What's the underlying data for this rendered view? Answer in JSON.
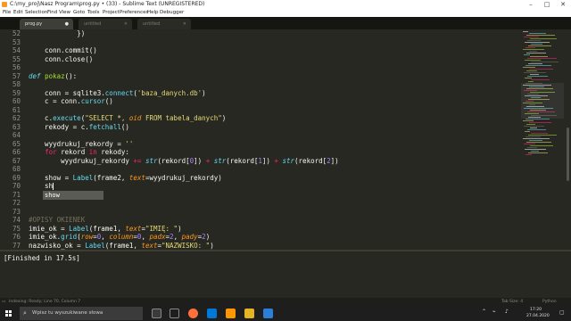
{
  "window": {
    "title": "C:\\my_proj\\Nasz Program\\prog.py • (33) - Sublime Text (UNREGISTERED)"
  },
  "menu": [
    "File",
    "Edit",
    "Selection",
    "Find",
    "View",
    "Goto",
    "Tools",
    "Project",
    "Preferences",
    "Help",
    "Debugger"
  ],
  "tabs": [
    {
      "label": "prog.py",
      "active": true
    },
    {
      "label": "untitled",
      "active": false
    },
    {
      "label": "untitled",
      "active": false
    }
  ],
  "editor": {
    "line_numbers": [
      "52",
      "53",
      "54",
      "55",
      "56",
      "57",
      "58",
      "59",
      "60",
      "61",
      "62",
      "63",
      "64",
      "65",
      "66",
      "67",
      "68",
      "69",
      "70",
      "71",
      "72",
      "73",
      "74",
      "75",
      "76",
      "77"
    ],
    "autocomplete": "show"
  },
  "output": {
    "text": "[Finished in 17.5s]"
  },
  "status": {
    "left": "Indexing: Ready; Line 70, Column 7",
    "tab_size": "Tab Size: 4",
    "syntax": "Python"
  },
  "taskbar": {
    "search_placeholder": "Wpisz tu wyszukiwane słowa",
    "time": "17:20",
    "date": "27.04.2020"
  },
  "colors": {
    "background": "#272822",
    "keyword": "#f92672",
    "string": "#e6db74",
    "function": "#66d9ef",
    "number": "#ae81ff"
  }
}
